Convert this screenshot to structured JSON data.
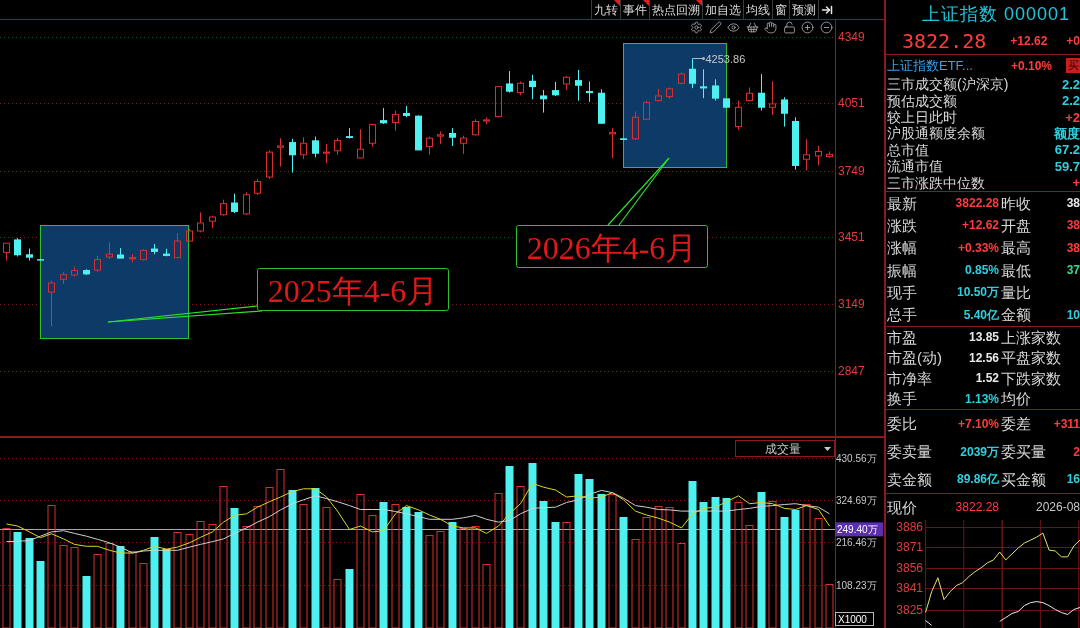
{
  "toolbar": {
    "buttons": [
      {
        "label": "九转",
        "badge": true
      },
      {
        "label": "事件",
        "badge": true
      },
      {
        "label": "热点回溯",
        "badge": true
      },
      {
        "label": "加自选",
        "badge": false
      },
      {
        "label": "均线",
        "badge": false
      },
      {
        "label": "窗",
        "badge": false
      },
      {
        "label": "预测",
        "badge": false
      }
    ]
  },
  "price_chart": {
    "chart_data": {
      "type": "candlestick",
      "ohlc": [
        [
          3381,
          3422,
          3344,
          3422
        ],
        [
          3437,
          3445,
          3362,
          3370
        ],
        [
          3370,
          3398,
          3344,
          3359
        ],
        [
          3348,
          3349,
          3345,
          3346
        ],
        [
          3202,
          3253,
          3048,
          3243
        ],
        [
          3260,
          3291,
          3239,
          3280
        ],
        [
          3279,
          3317,
          3272,
          3299
        ],
        [
          3299,
          3305,
          3279,
          3284
        ],
        [
          3301,
          3366,
          3292,
          3348
        ],
        [
          3360,
          3426,
          3351,
          3373
        ],
        [
          3369,
          3400,
          3354,
          3355
        ],
        [
          3352,
          3373,
          3336,
          3357
        ],
        [
          3348,
          3396,
          3345,
          3390
        ],
        [
          3396,
          3418,
          3372,
          3385
        ],
        [
          3373,
          3397,
          3363,
          3367
        ],
        [
          3357,
          3468,
          3354,
          3432
        ],
        [
          3432,
          3486,
          3429,
          3477
        ],
        [
          3477,
          3561,
          3471,
          3513
        ],
        [
          3521,
          3546,
          3490,
          3540
        ],
        [
          3550,
          3618,
          3546,
          3600
        ],
        [
          3603,
          3645,
          3558,
          3565
        ],
        [
          3554,
          3651,
          3550,
          3640
        ],
        [
          3647,
          3711,
          3639,
          3700
        ],
        [
          3720,
          3840,
          3711,
          3832
        ],
        [
          3854,
          3895,
          3767,
          3860
        ],
        [
          3875,
          3892,
          3740,
          3820
        ],
        [
          3820,
          3899,
          3801,
          3872
        ],
        [
          3883,
          3902,
          3809,
          3827
        ],
        [
          3827,
          3869,
          3782,
          3832
        ],
        [
          3838,
          3895,
          3820,
          3884
        ],
        [
          3902,
          3940,
          3893,
          3898
        ],
        [
          3806,
          3935,
          3806,
          3845
        ],
        [
          3872,
          3959,
          3857,
          3956
        ],
        [
          3974,
          4031,
          3959,
          3964
        ],
        [
          3965,
          4019,
          3929,
          4001
        ],
        [
          4006,
          4040,
          3989,
          3997
        ],
        [
          3994,
          3997,
          3842,
          3842
        ],
        [
          3857,
          3902,
          3820,
          3895
        ],
        [
          3904,
          3925,
          3869,
          3910
        ],
        [
          3916,
          3940,
          3860,
          3899
        ],
        [
          3872,
          3906,
          3824,
          3895
        ],
        [
          3910,
          3980,
          3907,
          3970
        ],
        [
          3972,
          3989,
          3958,
          3977
        ],
        [
          3992,
          4130,
          3989,
          4127
        ],
        [
          4139,
          4197,
          4100,
          4106
        ],
        [
          4100,
          4150,
          4088,
          4142
        ],
        [
          4151,
          4180,
          4070,
          4127
        ],
        [
          4085,
          4112,
          4010,
          4072
        ],
        [
          4109,
          4148,
          4085,
          4090
        ],
        [
          4139,
          4175,
          4112,
          4169
        ],
        [
          4154,
          4202,
          4063,
          4133
        ],
        [
          4105,
          4150,
          4058,
          4100
        ],
        [
          4097,
          4115,
          3959,
          3962
        ],
        [
          3914,
          3940,
          3805,
          3920
        ],
        [
          3892,
          3893,
          3888,
          3889
        ],
        [
          3892,
          4015,
          3887,
          3989
        ],
        [
          3980,
          4064,
          3977,
          4055
        ],
        [
          4064,
          4117,
          4060,
          4085
        ],
        [
          4082,
          4123,
          4073,
          4117
        ],
        [
          4142,
          4190,
          4137,
          4184
        ],
        [
          4205,
          4253.86,
          4120,
          4142
        ],
        [
          4126,
          4205,
          4075,
          4121
        ],
        [
          4130,
          4160,
          4064,
          4075
        ],
        [
          4072,
          4072,
          4034,
          4034
        ],
        [
          3947,
          4064,
          3932,
          4034
        ],
        [
          4064,
          4123,
          4060,
          4097
        ],
        [
          4097,
          4183,
          4019,
          4034
        ],
        [
          4034,
          4150,
          3999,
          4049
        ],
        [
          4067,
          4079,
          3947,
          4007
        ],
        [
          3970,
          3989,
          3753,
          3772
        ],
        [
          3800,
          3890,
          3750,
          3820
        ],
        [
          3815,
          3860,
          3772,
          3835
        ],
        [
          3812,
          3835,
          3806,
          3822.28
        ]
      ],
      "ylim": [
        2552,
        4429
      ],
      "yticks": [
        4349,
        4051,
        3749,
        3451,
        3149,
        2847
      ],
      "grid": true,
      "annotations": [
        "2025年4-6月",
        "2026年4-6月",
        "4253.86"
      ]
    }
  },
  "volume_chart": {
    "indicator": "成交量",
    "chart_data": {
      "type": "bar",
      "series": [
        {
          "values": [
            253,
            243,
            228,
            169,
            312,
            209,
            204,
            129,
            186,
            215,
            208,
            194,
            164,
            229,
            198,
            242,
            238,
            272,
            263,
            360,
            305,
            258,
            308,
            357,
            403,
            350,
            315,
            356,
            306,
            122,
            148,
            340,
            285,
            320,
            315,
            306,
            293,
            236,
            246,
            269,
            253,
            258,
            162,
            342,
            412,
            360,
            419,
            323,
            268,
            268,
            390,
            379,
            340,
            340,
            282,
            225,
            281,
            308,
            306,
            214,
            372,
            320,
            333,
            330,
            318,
            261,
            346,
            322,
            282,
            299,
            315,
            279,
            111
          ],
          "colors": [
            "#d83030",
            "#4ef0f0",
            "#4ef0f0",
            "#4ef0f0",
            "#d83030",
            "#d83030",
            "#d83030",
            "#4ef0f0",
            "#d83030",
            "#d83030",
            "#4ef0f0",
            "#d83030",
            "#d83030",
            "#4ef0f0",
            "#4ef0f0",
            "#d83030",
            "#d83030",
            "#d83030",
            "#d83030",
            "#d83030",
            "#4ef0f0",
            "#d83030",
            "#d83030",
            "#d83030",
            "#d83030",
            "#4ef0f0",
            "#d83030",
            "#4ef0f0",
            "#d83030",
            "#d83030",
            "#4ef0f0",
            "#d83030",
            "#d83030",
            "#4ef0f0",
            "#d83030",
            "#4ef0f0",
            "#4ef0f0",
            "#d83030",
            "#d83030",
            "#4ef0f0",
            "#d83030",
            "#d83030",
            "#d83030",
            "#d83030",
            "#4ef0f0",
            "#d83030",
            "#4ef0f0",
            "#4ef0f0",
            "#4ef0f0",
            "#d83030",
            "#4ef0f0",
            "#4ef0f0",
            "#4ef0f0",
            "#d83030",
            "#4ef0f0",
            "#d83030",
            "#d83030",
            "#d83030",
            "#d83030",
            "#d83030",
            "#4ef0f0",
            "#4ef0f0",
            "#4ef0f0",
            "#4ef0f0",
            "#d83030",
            "#d83030",
            "#4ef0f0",
            "#d83030",
            "#4ef0f0",
            "#4ef0f0",
            "#d83030",
            "#d83030",
            "#d83030"
          ]
        },
        {
          "type": "line",
          "color": "#d8d820",
          "values": [
            263,
            258,
            243,
            228,
            238,
            225,
            211,
            206,
            206,
            196,
            189,
            189,
            196,
            206,
            199,
            204,
            215,
            229,
            243,
            268,
            285,
            289,
            306,
            320,
            332,
            346,
            353,
            353,
            332,
            296,
            249,
            258,
            243,
            246,
            289,
            310,
            299,
            286,
            275,
            258,
            253,
            253,
            239,
            258,
            289,
            315,
            367,
            357,
            350,
            332,
            335,
            329,
            332,
            343,
            325,
            296,
            286,
            278,
            268,
            253,
            289,
            303,
            306,
            320,
            335,
            315,
            318,
            315,
            303,
            300,
            310,
            300,
            258
          ]
        },
        {
          "type": "line",
          "color": "#d0d0d0",
          "values": [
            218,
            219,
            221,
            232,
            243,
            246,
            239,
            232,
            224,
            215,
            204,
            189,
            194,
            196,
            196,
            196,
            204,
            211,
            218,
            225,
            239,
            253,
            268,
            282,
            299,
            315,
            325,
            335,
            328,
            320,
            310,
            300,
            300,
            300,
            295,
            289,
            282,
            275,
            275,
            275,
            279,
            285,
            275,
            268,
            272,
            289,
            303,
            305,
            306,
            318,
            325,
            339,
            349,
            343,
            329,
            310,
            306,
            300,
            299,
            296,
            296,
            296,
            296,
            296,
            300,
            303,
            308,
            310,
            313,
            315,
            310,
            306,
            289
          ]
        }
      ],
      "ylim": [
        0,
        484
      ],
      "yticks": [
        {
          "value": 430.56,
          "label": "430.56万"
        },
        {
          "value": 324.69,
          "label": "324.69万"
        },
        {
          "value": 216.46,
          "label": "216.46万"
        },
        {
          "value": 108.23,
          "label": "108.23万"
        }
      ],
      "grid": true,
      "ref_lines": [
        {
          "axis": "y",
          "value": 249.4,
          "label": "249.40万",
          "color": "#a8a8a8"
        }
      ],
      "annotations": [
        "X1000"
      ]
    }
  },
  "quote_panel": {
    "title": "上证指数 000001",
    "price": "3822.28",
    "change": "+12.62",
    "change_pct": "+0",
    "etf": {
      "name": "上证指数ETF...",
      "change": "+0.10%",
      "action": "买"
    },
    "stats": [
      {
        "label": "三市成交额(沪深京)",
        "value": "2.2",
        "color": "#2ed0e0"
      },
      {
        "label": "预估成交额",
        "value": "2.2",
        "color": "#2ed0e0"
      },
      {
        "label": "较上日此时",
        "value": "+2",
        "color": "#ff3c3c"
      },
      {
        "label": "沪股通额度余额",
        "value": "额度",
        "color": "#2ed0e0"
      },
      {
        "label": "总市值",
        "value": "67.2",
        "color": "#2ed0e0"
      },
      {
        "label": "流通市值",
        "value": "59.7",
        "color": "#2ed0e0"
      },
      {
        "label": "三市涨跌中位数",
        "value": "+",
        "color": "#ff3c3c"
      }
    ],
    "groups": [
      [
        {
          "left": {
            "label": "最新",
            "value": "3822.28",
            "color": "#ff3c3c"
          },
          "right": {
            "label": "昨收",
            "value": "38",
            "color": "#e8e8e8"
          }
        },
        {
          "left": {
            "label": "涨跌",
            "value": "+12.62",
            "color": "#ff3c3c"
          },
          "right": {
            "label": "开盘",
            "value": "38",
            "color": "#ff3c3c"
          }
        },
        {
          "left": {
            "label": "涨幅",
            "value": "+0.33%",
            "color": "#ff3c3c"
          },
          "right": {
            "label": "最高",
            "value": "38",
            "color": "#ff3c3c"
          }
        },
        {
          "left": {
            "label": "振幅",
            "value": "0.85%",
            "color": "#2ed0e0"
          },
          "right": {
            "label": "最低",
            "value": "37",
            "color": "#3cd68c"
          }
        },
        {
          "left": {
            "label": "现手",
            "value": "10.50万",
            "color": "#2ed0e0"
          },
          "right": {
            "label": "量比"
          }
        },
        {
          "left": {
            "label": "总手",
            "value": "5.40亿",
            "color": "#2ed0e0"
          },
          "right": {
            "label": "金额",
            "value": "10",
            "color": "#2ed0e0"
          }
        }
      ],
      [
        {
          "left": {
            "label": "市盈",
            "value": "13.85",
            "color": "#e8e8e8"
          },
          "right": {
            "label": "上涨家数"
          }
        },
        {
          "left": {
            "label": "市盈(动)",
            "value": "12.56",
            "color": "#e8e8e8"
          },
          "right": {
            "label": "平盘家数"
          }
        },
        {
          "left": {
            "label": "市净率",
            "value": "1.52",
            "color": "#e8e8e8"
          },
          "right": {
            "label": "下跌家数"
          }
        },
        {
          "left": {
            "label": "换手",
            "value": "1.13%",
            "color": "#2ed0e0"
          },
          "right": {
            "label": "均价"
          }
        }
      ],
      [
        {
          "left": {
            "label": "委比",
            "value": "+7.10%",
            "color": "#ff3c3c"
          },
          "right": {
            "label": "委差",
            "value": "+311",
            "color": "#ff3c3c"
          }
        },
        {
          "left": {
            "label": "委卖量",
            "value": "2039万",
            "color": "#2ed0e0"
          },
          "right": {
            "label": "委买量",
            "value": "2",
            "color": "#ff3c3c"
          }
        },
        {
          "left": {
            "label": "卖金额",
            "value": "89.86亿",
            "color": "#2ed0e0"
          },
          "right": {
            "label": "买金额",
            "value": "16",
            "color": "#2ed0e0"
          }
        }
      ]
    ],
    "intraday": {
      "label": "现价",
      "price": "3822.28",
      "date": "2026-08",
      "chart_data": {
        "type": "line",
        "series": [
          {
            "color": "#e8e070",
            "values": [
              3823.3,
              3838.6,
              3848.8,
              3832.8,
              3838.6,
              3843.0,
              3845.1,
              3849.5,
              3853.1,
              3856.0,
              3859.6,
              3861.8,
              3867.6,
              3861.8,
              3866.2,
              3870.5,
              3874.2,
              3876.3,
              3878.5,
              3881.4,
              3869.0,
              3868.3,
              3864.0,
              3864.0,
              3872.0,
              3876.3
            ]
          },
          {
            "color": "#e8e8e8",
            "values": [
              3817.5,
              3813.9,
              null,
              null,
              null,
              null,
              null,
              null,
              null,
              null,
              null,
              null,
              3816.8,
              3819.7,
              3822.6,
              3824.1,
              3828.4,
              3830.6,
              3831.3,
              3830.6,
              3828.4,
              3825.5,
              3823.3,
              3821.9,
              3825.5,
              3827.0
            ]
          }
        ],
        "ylim": [
          3812,
          3891
        ],
        "yticks": [
          3886,
          3871,
          3856,
          3841,
          3825
        ],
        "grid": true
      }
    }
  }
}
